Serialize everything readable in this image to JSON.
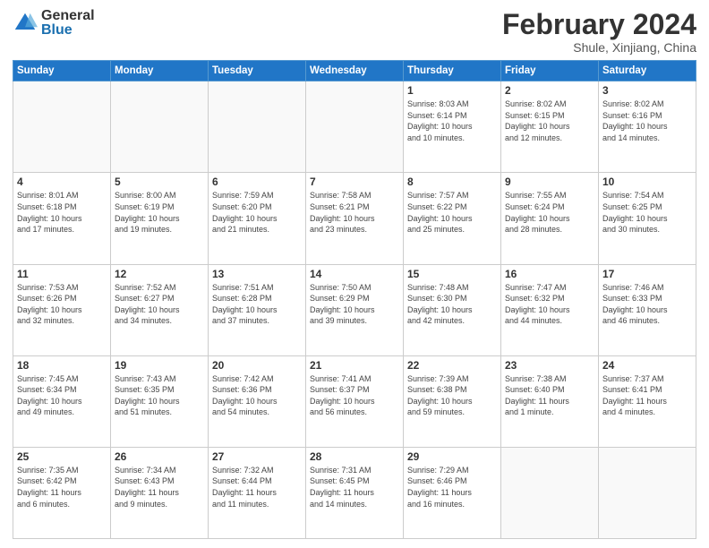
{
  "header": {
    "logo_general": "General",
    "logo_blue": "Blue",
    "title": "February 2024",
    "subtitle": "Shule, Xinjiang, China"
  },
  "days_of_week": [
    "Sunday",
    "Monday",
    "Tuesday",
    "Wednesday",
    "Thursday",
    "Friday",
    "Saturday"
  ],
  "weeks": [
    [
      {
        "day": "",
        "info": ""
      },
      {
        "day": "",
        "info": ""
      },
      {
        "day": "",
        "info": ""
      },
      {
        "day": "",
        "info": ""
      },
      {
        "day": "1",
        "info": "Sunrise: 8:03 AM\nSunset: 6:14 PM\nDaylight: 10 hours\nand 10 minutes."
      },
      {
        "day": "2",
        "info": "Sunrise: 8:02 AM\nSunset: 6:15 PM\nDaylight: 10 hours\nand 12 minutes."
      },
      {
        "day": "3",
        "info": "Sunrise: 8:02 AM\nSunset: 6:16 PM\nDaylight: 10 hours\nand 14 minutes."
      }
    ],
    [
      {
        "day": "4",
        "info": "Sunrise: 8:01 AM\nSunset: 6:18 PM\nDaylight: 10 hours\nand 17 minutes."
      },
      {
        "day": "5",
        "info": "Sunrise: 8:00 AM\nSunset: 6:19 PM\nDaylight: 10 hours\nand 19 minutes."
      },
      {
        "day": "6",
        "info": "Sunrise: 7:59 AM\nSunset: 6:20 PM\nDaylight: 10 hours\nand 21 minutes."
      },
      {
        "day": "7",
        "info": "Sunrise: 7:58 AM\nSunset: 6:21 PM\nDaylight: 10 hours\nand 23 minutes."
      },
      {
        "day": "8",
        "info": "Sunrise: 7:57 AM\nSunset: 6:22 PM\nDaylight: 10 hours\nand 25 minutes."
      },
      {
        "day": "9",
        "info": "Sunrise: 7:55 AM\nSunset: 6:24 PM\nDaylight: 10 hours\nand 28 minutes."
      },
      {
        "day": "10",
        "info": "Sunrise: 7:54 AM\nSunset: 6:25 PM\nDaylight: 10 hours\nand 30 minutes."
      }
    ],
    [
      {
        "day": "11",
        "info": "Sunrise: 7:53 AM\nSunset: 6:26 PM\nDaylight: 10 hours\nand 32 minutes."
      },
      {
        "day": "12",
        "info": "Sunrise: 7:52 AM\nSunset: 6:27 PM\nDaylight: 10 hours\nand 34 minutes."
      },
      {
        "day": "13",
        "info": "Sunrise: 7:51 AM\nSunset: 6:28 PM\nDaylight: 10 hours\nand 37 minutes."
      },
      {
        "day": "14",
        "info": "Sunrise: 7:50 AM\nSunset: 6:29 PM\nDaylight: 10 hours\nand 39 minutes."
      },
      {
        "day": "15",
        "info": "Sunrise: 7:48 AM\nSunset: 6:30 PM\nDaylight: 10 hours\nand 42 minutes."
      },
      {
        "day": "16",
        "info": "Sunrise: 7:47 AM\nSunset: 6:32 PM\nDaylight: 10 hours\nand 44 minutes."
      },
      {
        "day": "17",
        "info": "Sunrise: 7:46 AM\nSunset: 6:33 PM\nDaylight: 10 hours\nand 46 minutes."
      }
    ],
    [
      {
        "day": "18",
        "info": "Sunrise: 7:45 AM\nSunset: 6:34 PM\nDaylight: 10 hours\nand 49 minutes."
      },
      {
        "day": "19",
        "info": "Sunrise: 7:43 AM\nSunset: 6:35 PM\nDaylight: 10 hours\nand 51 minutes."
      },
      {
        "day": "20",
        "info": "Sunrise: 7:42 AM\nSunset: 6:36 PM\nDaylight: 10 hours\nand 54 minutes."
      },
      {
        "day": "21",
        "info": "Sunrise: 7:41 AM\nSunset: 6:37 PM\nDaylight: 10 hours\nand 56 minutes."
      },
      {
        "day": "22",
        "info": "Sunrise: 7:39 AM\nSunset: 6:38 PM\nDaylight: 10 hours\nand 59 minutes."
      },
      {
        "day": "23",
        "info": "Sunrise: 7:38 AM\nSunset: 6:40 PM\nDaylight: 11 hours\nand 1 minute."
      },
      {
        "day": "24",
        "info": "Sunrise: 7:37 AM\nSunset: 6:41 PM\nDaylight: 11 hours\nand 4 minutes."
      }
    ],
    [
      {
        "day": "25",
        "info": "Sunrise: 7:35 AM\nSunset: 6:42 PM\nDaylight: 11 hours\nand 6 minutes."
      },
      {
        "day": "26",
        "info": "Sunrise: 7:34 AM\nSunset: 6:43 PM\nDaylight: 11 hours\nand 9 minutes."
      },
      {
        "day": "27",
        "info": "Sunrise: 7:32 AM\nSunset: 6:44 PM\nDaylight: 11 hours\nand 11 minutes."
      },
      {
        "day": "28",
        "info": "Sunrise: 7:31 AM\nSunset: 6:45 PM\nDaylight: 11 hours\nand 14 minutes."
      },
      {
        "day": "29",
        "info": "Sunrise: 7:29 AM\nSunset: 6:46 PM\nDaylight: 11 hours\nand 16 minutes."
      },
      {
        "day": "",
        "info": ""
      },
      {
        "day": "",
        "info": ""
      }
    ]
  ]
}
